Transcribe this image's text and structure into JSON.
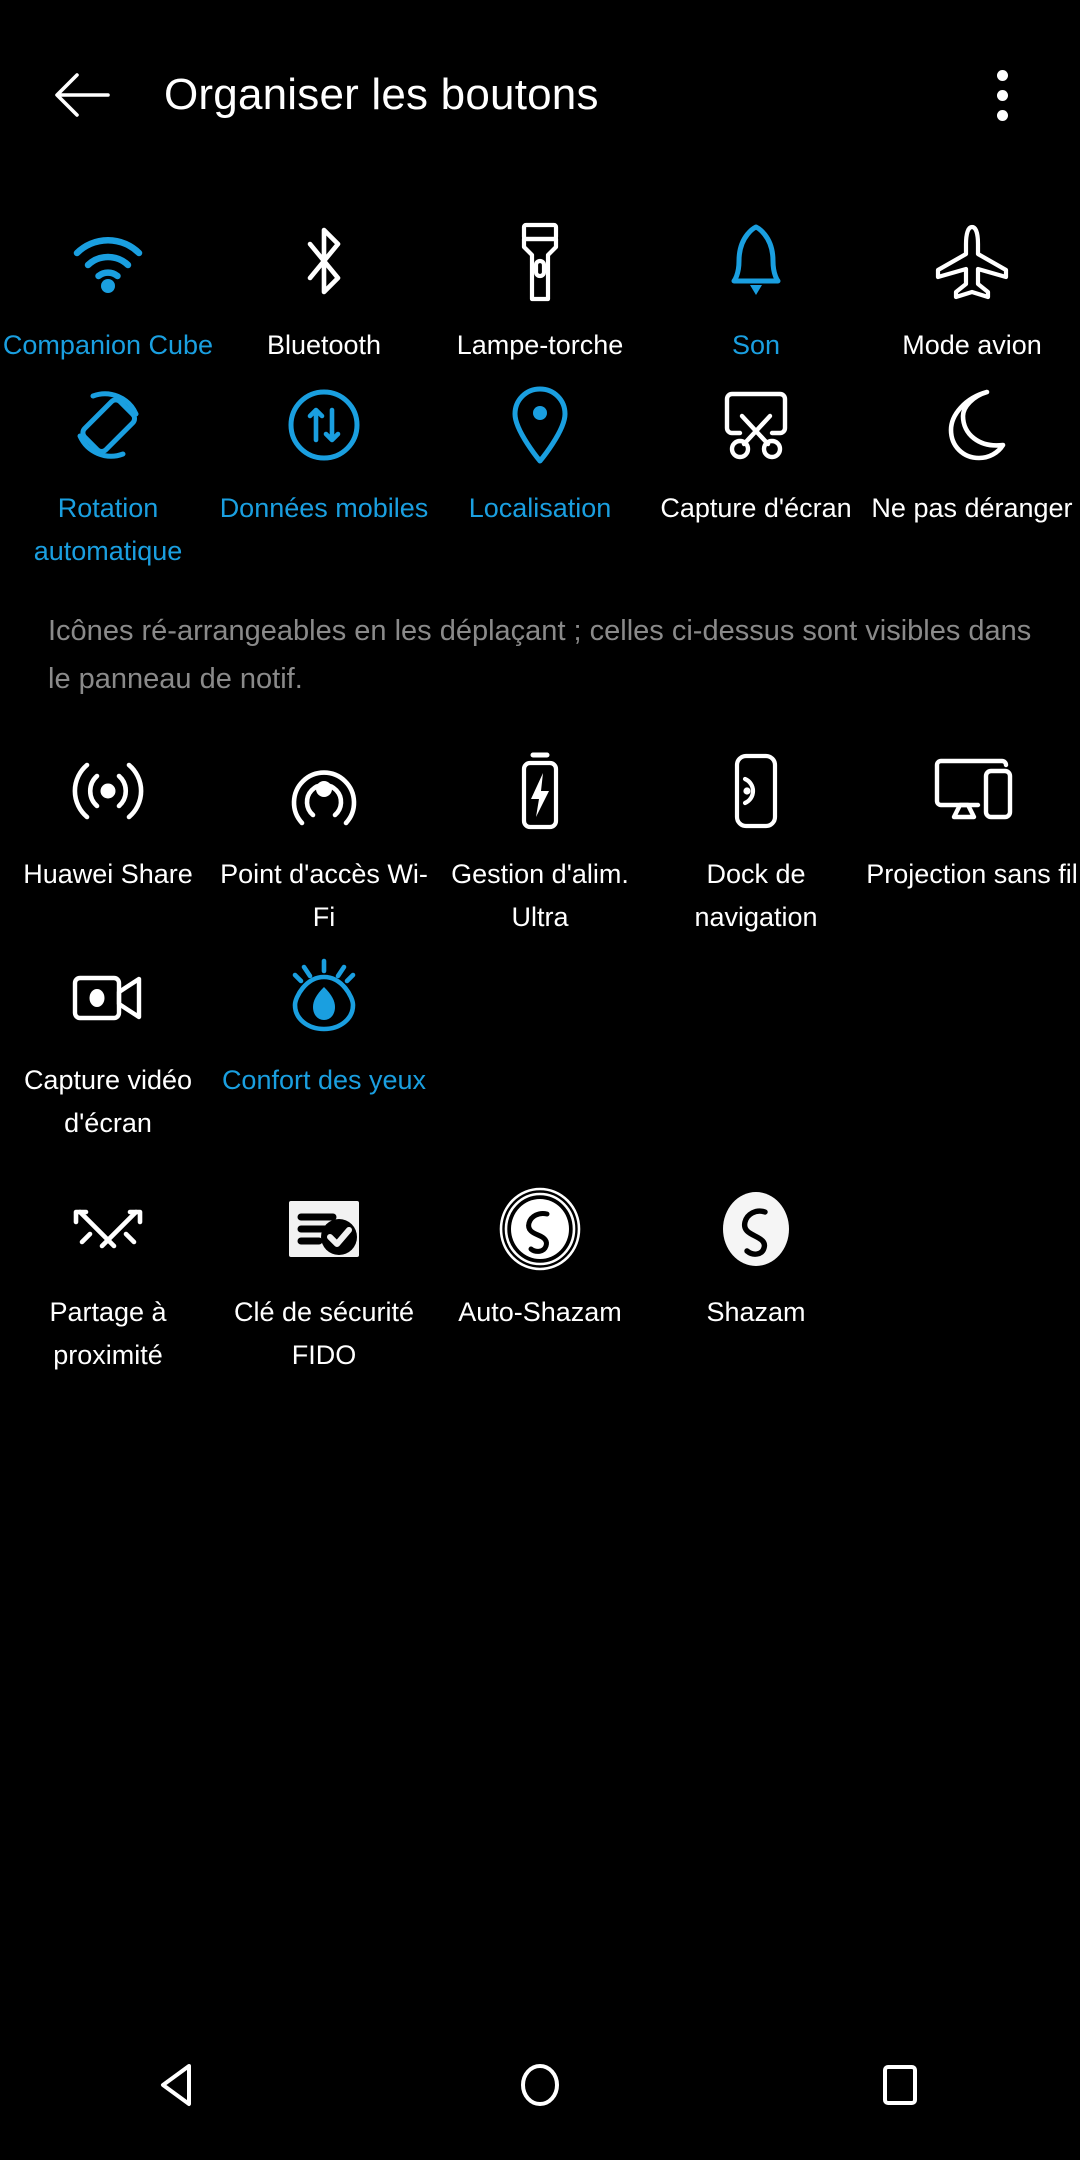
{
  "header": {
    "title": "Organiser les boutons",
    "back_icon": "arrow-left-icon",
    "menu_icon": "overflow-menu-icon"
  },
  "hint": "Icônes ré-arrangeables en les déplaçant ; celles ci-dessus sont visibles dans le panneau de notif.",
  "colors": {
    "background": "#000000",
    "accent_on": "#1a9fe0",
    "text_off": "#ffffff",
    "hint_text": "#8a8a8a"
  },
  "active_tiles": {
    "icons": [
      {
        "label": "Companion Cube",
        "icon": "wifi-icon",
        "state": "on"
      },
      {
        "label": "Bluetooth",
        "icon": "bluetooth-icon",
        "state": "off"
      },
      {
        "label": "Lampe-torche",
        "icon": "flashlight-icon",
        "state": "off"
      },
      {
        "label": "Son",
        "icon": "bell-icon",
        "state": "on"
      },
      {
        "label": "Mode avion",
        "icon": "airplane-icon",
        "state": "off"
      },
      {
        "label": "Rotation automatique",
        "icon": "auto-rotate-icon",
        "state": "on"
      },
      {
        "label": "Données mobiles",
        "icon": "mobile-data-icon",
        "state": "on"
      },
      {
        "label": "Localisation",
        "icon": "location-pin-icon",
        "state": "on"
      },
      {
        "label": "Capture d'écran",
        "icon": "screenshot-scissors-icon",
        "state": "off"
      },
      {
        "label": "Ne pas déranger",
        "icon": "moon-icon",
        "state": "off"
      }
    ]
  },
  "available_tiles": {
    "icons": [
      {
        "label": "Huawei Share",
        "icon": "huawei-share-icon",
        "state": "off"
      },
      {
        "label": "Point d'accès Wi-Fi",
        "icon": "hotspot-icon",
        "state": "off"
      },
      {
        "label": "Gestion d'alim. Ultra",
        "icon": "battery-bolt-icon",
        "state": "off"
      },
      {
        "label": "Dock de navigation",
        "icon": "nav-dock-icon",
        "state": "off"
      },
      {
        "label": "Projection sans fil",
        "icon": "wireless-projection-icon",
        "state": "off"
      },
      {
        "label": "Capture vidéo d'écran",
        "icon": "screen-recorder-icon",
        "state": "off"
      },
      {
        "label": "Confort des yeux",
        "icon": "eye-comfort-icon",
        "state": "on"
      }
    ]
  },
  "extra_tiles": {
    "icons": [
      {
        "label": "Partage à proximité",
        "icon": "nearby-share-icon",
        "state": "off"
      },
      {
        "label": "Clé de sécurité FIDO",
        "icon": "fido-security-key-icon",
        "state": "off"
      },
      {
        "label": "Auto-Shazam",
        "icon": "auto-shazam-icon",
        "state": "off"
      },
      {
        "label": "Shazam",
        "icon": "shazam-icon",
        "state": "off"
      }
    ]
  },
  "navbar": {
    "buttons": [
      {
        "name": "back",
        "icon": "nav-back-triangle-icon"
      },
      {
        "name": "home",
        "icon": "nav-home-circle-icon"
      },
      {
        "name": "recents",
        "icon": "nav-recents-square-icon"
      }
    ]
  }
}
